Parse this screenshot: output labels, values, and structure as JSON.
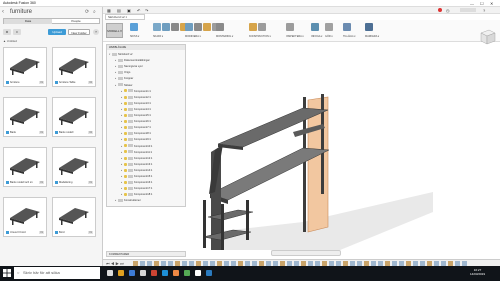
{
  "window": {
    "title": "Autodesk Fusion 360",
    "controls": [
      "—",
      "☐",
      "✕"
    ]
  },
  "left_panel": {
    "breadcrumb": "furniture",
    "tabs": [
      "Data",
      "People"
    ],
    "upload_label": "Upload",
    "new_folder_label": "New Folder",
    "path": "▲  Untitled",
    "items": [
      {
        "name": "furniture",
        "version": "V1"
      },
      {
        "name": "furniture Table",
        "version": "V2"
      },
      {
        "name": "Bank",
        "version": "V1"
      },
      {
        "name": "Bank modell",
        "version": "V2"
      },
      {
        "name": "Bank modell och s1",
        "version": "V1"
      },
      {
        "name": "Modellering",
        "version": "V1"
      },
      {
        "name": "Ursus III bord",
        "version": "V1"
      },
      {
        "name": "Bord",
        "version": "V1"
      }
    ]
  },
  "main": {
    "doc_tab": "Skrivbord v2 ×",
    "design_label": "MODELL ▾",
    "tool_groups": [
      "SKISS ▾",
      "SKAPA ▾",
      "MODIFIERA ▾",
      "MONTERING ▾",
      "KONSTRUKTION ▾",
      "INSPEKTERA ▾",
      "INFOGA ▾",
      "GÖR ▾",
      "TILLÄGG ▾",
      "MARKERA ▾"
    ],
    "browser_title": "WEBBLÄSARE",
    "tree": {
      "root": "Skrivbord v2",
      "top_items": [
        "Dokumentinställningar",
        "Namngivna vyer",
        "Origo",
        "Kroppar",
        "Skisser"
      ],
      "components": [
        "Komponent1:1",
        "Komponent2:1",
        "Komponent3:1",
        "Komponent4:1",
        "Komponent5:1",
        "Komponent6:1",
        "Komponent7:1",
        "Komponent8:1",
        "Komponent9:1",
        "Komponent10:1",
        "Komponent11:1",
        "Komponent12:1",
        "Komponent13:1",
        "Komponent14:1",
        "Komponent15:1",
        "Komponent16:1",
        "Komponent17:1",
        "Komponent18:1"
      ],
      "last": "Konstruktioner"
    },
    "comments_label": "KOMMENTARER"
  },
  "taskbar": {
    "search_placeholder": "Skriv här för att söka",
    "time": "16:27",
    "date": "14/03/2019"
  },
  "colors": {
    "accent": "#3d9bd6",
    "taskbar": "#101419",
    "model_dark": "#4a4a4a",
    "model_highlight": "#f2c7a0"
  }
}
